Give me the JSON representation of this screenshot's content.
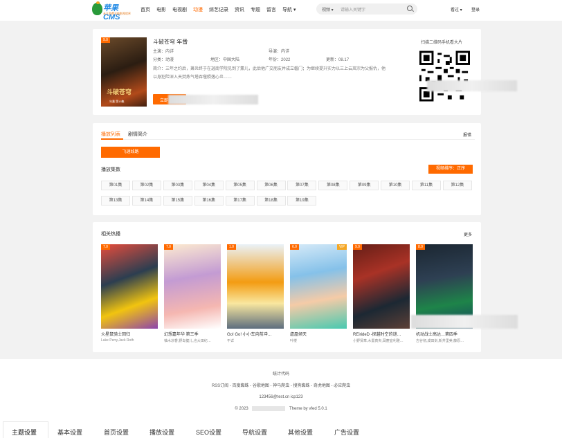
{
  "header": {
    "logo_text": "苹果CMS",
    "logo_sub": "永久免费全能影视程序",
    "nav": [
      "首页",
      "电影",
      "电视剧",
      "动漫",
      "综艺记录",
      "资讯",
      "专题",
      "留言",
      "导航 ▾"
    ],
    "active_nav": "动漫",
    "search_type": "视频 ▾",
    "search_placeholder": "请输入关键字",
    "history": "看过 ▾",
    "login": "登录"
  },
  "detail": {
    "score": "9.0",
    "poster_title": "斗破苍穹",
    "poster_foot": "年番 第19集",
    "title": "斗破苍穹 年番",
    "starring_label": "主演：",
    "starring": "内详",
    "director_label": "导演：",
    "director": "内详",
    "genre_label": "分类：",
    "genre": "动漫",
    "area_label": "地区：",
    "area": "中国大陆",
    "year_label": "年份：",
    "year": "2022",
    "update_label": "更新：",
    "update": "08.17",
    "intro": "简介：三年之约后，萧炎终于在迦南学院见到了薰儿，此后他广交朋友并成立磐门；为继续提升实力以三上云岚宗为父报仇，他以身犯险深入天焚炼气塔吞噬陨落心炎……",
    "play_label": "立即",
    "qr_caption": "扫描二维码手机看大片"
  },
  "playlist": {
    "tabs": [
      "播放列表",
      "剧情简介"
    ],
    "report": "报错",
    "source": "飞速线路",
    "episodes_label": "播放集数",
    "sort_label": "视频排序：正序",
    "episodes": [
      "第01集",
      "第02集",
      "第03集",
      "第04集",
      "第05集",
      "第06集",
      "第07集",
      "第08集",
      "第09集",
      "第10集",
      "第11集",
      "第12集",
      "第13集",
      "第14集",
      "第15集",
      "第16集",
      "第17集",
      "第18集",
      "第19集"
    ]
  },
  "related": {
    "title": "相关热播",
    "more": "更多",
    "cards": [
      {
        "score": "7.0",
        "name": "火星鼠骑士回归",
        "actors": "Luke Perry,Jack Roth",
        "vip": ""
      },
      {
        "score": "7.0",
        "name": "幻想嘉年华 第三季",
        "actors": "柚木凉香,野岛健儿,也大田纪…",
        "vip": ""
      },
      {
        "score": "1.0",
        "name": "Go! Go! 小小车向前冲…",
        "actors": "不详",
        "vip": ""
      },
      {
        "score": "6.0",
        "name": "虐凰倾天",
        "actors": "叶楼",
        "vip": "VIP"
      },
      {
        "score": "9.0",
        "name": "REirideD -探越时空的谜…",
        "actors": "小野贤章,木置真央,岡塵宜利雅…",
        "vip": ""
      },
      {
        "score": "8.0",
        "name": "机动战士高达…第四季",
        "actors": "古谷彻,成田剑,新井里美,藤原…",
        "vip": ""
      }
    ]
  },
  "footer": {
    "stats": "统计代码",
    "links": "RSS订阅 - 百度蜘蛛 - 谷歌地图 - 神马爬虫 - 搜狗蜘蛛 - 奇虎地图 - 必应爬虫",
    "contact": "123456@test.cn   icp123",
    "copyright_prefix": "© 2023",
    "theme": "Theme by vfed 5.0.1"
  },
  "bottom_tabs": [
    "主题设置",
    "基本设置",
    "首页设置",
    "播放设置",
    "SEO设置",
    "导航设置",
    "其他设置",
    "广告设置"
  ],
  "colors": {
    "accent": "#ff6a00",
    "bg": "#f2f2f2"
  }
}
